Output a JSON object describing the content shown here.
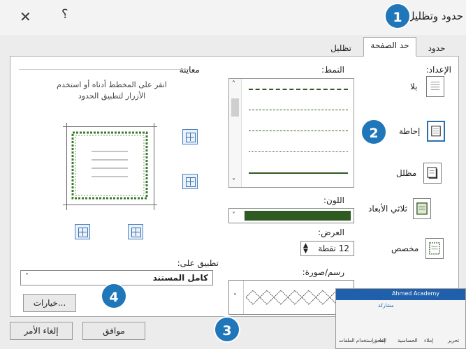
{
  "window": {
    "title": "حدود وتظليل",
    "close_icon": "close-icon",
    "help_label": "؟"
  },
  "tabs": [
    {
      "label": "حدود"
    },
    {
      "label": "حد الصفحة"
    },
    {
      "label": "تظليل"
    }
  ],
  "settings": {
    "heading": "الإعداد:",
    "items": [
      {
        "label": "بلا"
      },
      {
        "label": "إحاطة"
      },
      {
        "label": "مظلل"
      },
      {
        "label": "ثلاثي الأبعاد"
      },
      {
        "label": "مخصص"
      }
    ]
  },
  "style": {
    "heading": "النمط:"
  },
  "color": {
    "heading": "اللون:",
    "value": "#2f5a22"
  },
  "width": {
    "heading": "العرض:",
    "value": "12 نقطة"
  },
  "art": {
    "heading": "رسم/صورة:"
  },
  "preview": {
    "heading": "معاينة",
    "hint_line1": "انقر على المخطط أدناه أو استخدم",
    "hint_line2": "الأزرار لتطبيق الحدود"
  },
  "apply": {
    "heading": "تطبيق على:",
    "value": "كامل المستند"
  },
  "buttons": {
    "options": "خيارات...",
    "ok": "موافق",
    "cancel": "إلغاء الأمر"
  },
  "markers": [
    "1",
    "2",
    "3",
    "4"
  ],
  "ribbon": {
    "title": "Ahmed Academy",
    "share": "مشاركة",
    "tools": [
      "تحرير",
      "إملاء",
      "الحساسية",
      "المحرر",
      "إعادة استخدام الملفات"
    ]
  }
}
